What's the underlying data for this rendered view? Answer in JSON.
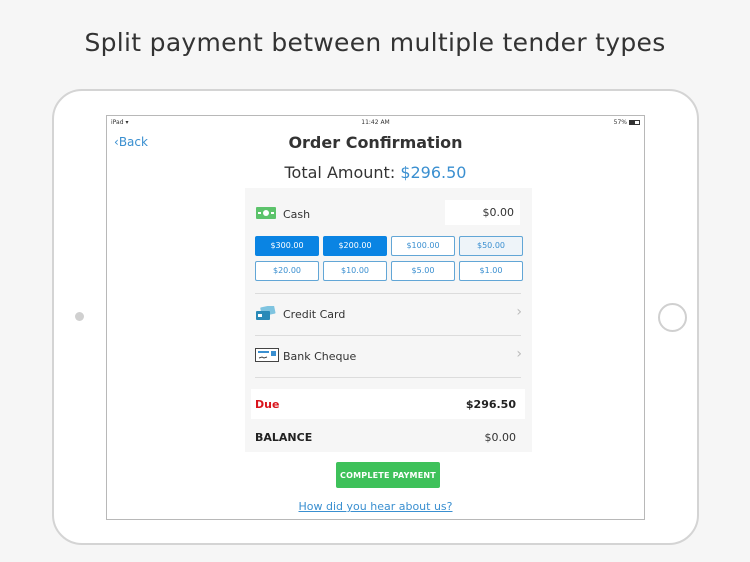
{
  "headline": "Split payment between multiple tender types",
  "status_bar": {
    "device": "iPad",
    "time": "11:42 AM",
    "battery": "57%"
  },
  "nav": {
    "back_label": "Back",
    "title": "Order Confirmation"
  },
  "total": {
    "label": "Total Amount:",
    "amount": "$296.50"
  },
  "cash": {
    "label": "Cash",
    "value": "$0.00"
  },
  "denominations": [
    {
      "label": "$300.00",
      "selected": true
    },
    {
      "label": "$200.00",
      "selected": true
    },
    {
      "label": "$100.00",
      "selected": false
    },
    {
      "label": "$50.00",
      "selected": false
    },
    {
      "label": "$20.00",
      "selected": false
    },
    {
      "label": "$10.00",
      "selected": false
    },
    {
      "label": "$5.00",
      "selected": false
    },
    {
      "label": "$1.00",
      "selected": false
    }
  ],
  "tenders": [
    {
      "label": "Credit Card",
      "icon": "credit-card-icon"
    },
    {
      "label": "Bank Cheque",
      "icon": "cheque-icon"
    }
  ],
  "summary": {
    "due_label": "Due",
    "due_value": "$296.50",
    "balance_label": "BALANCE",
    "balance_value": "$0.00"
  },
  "actions": {
    "complete_label": "COMPLETE PAYMENT",
    "survey_link": "How did you hear about us?"
  },
  "colors": {
    "accent": "#3a8fd0",
    "selected": "#0a84e3",
    "success": "#3ec15a",
    "danger": "#d9141c"
  }
}
